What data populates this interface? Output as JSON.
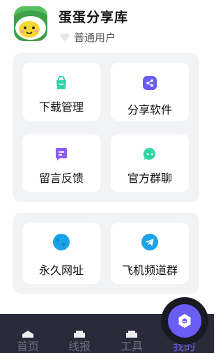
{
  "header": {
    "avatar_icon": "smiling-egg-avatar",
    "app_name": "蛋蛋分享库",
    "user_level_icon": "heart-icon",
    "user_level": "普通用户"
  },
  "menu1": [
    {
      "label": "下载管理",
      "icon": "download-bag-icon",
      "color": "#2ed6a6"
    },
    {
      "label": "分享软件",
      "icon": "share-icon",
      "color": "#6a5df5"
    },
    {
      "label": "留言反馈",
      "icon": "message-icon",
      "color": "#8b5cf6"
    },
    {
      "label": "官方群聊",
      "icon": "chat-bubble-icon",
      "color": "#2ed6a6"
    }
  ],
  "menu2": [
    {
      "label": "永久网址",
      "icon": "globe-icon",
      "color": "#1aa3e8"
    },
    {
      "label": "飞机频道群",
      "icon": "telegram-icon",
      "color": "#1aa3e8"
    }
  ],
  "tabbar": [
    {
      "label": "首页",
      "icon": "home-icon"
    },
    {
      "label": "线报",
      "icon": "news-icon"
    },
    {
      "label": "工具",
      "icon": "tools-icon"
    },
    {
      "label": "我的",
      "icon": "profile-icon",
      "active": true
    }
  ],
  "colors": {
    "accent": "#6a5df5",
    "tabbar_bg": "#2a2b3a",
    "panel_bg": "#f2f3f5"
  }
}
